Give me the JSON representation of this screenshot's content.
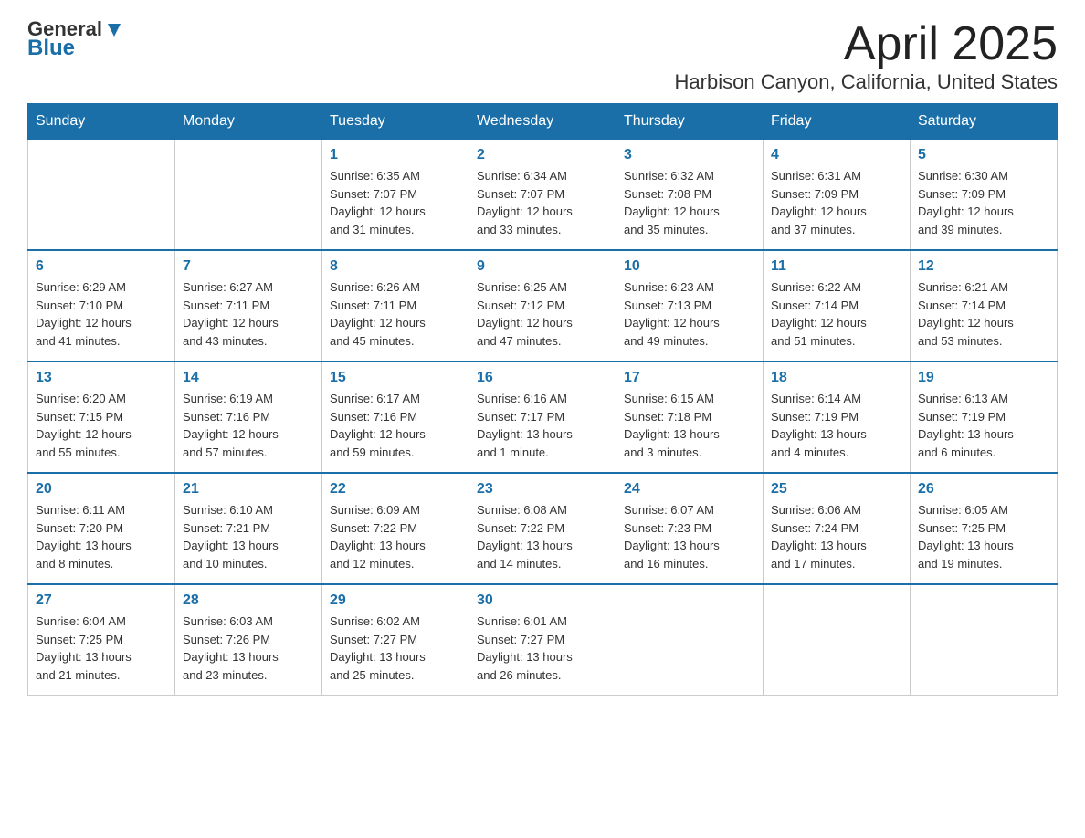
{
  "title": "April 2025",
  "subtitle": "Harbison Canyon, California, United States",
  "logo": {
    "line1": "General",
    "line2": "Blue"
  },
  "weekdays": [
    "Sunday",
    "Monday",
    "Tuesday",
    "Wednesday",
    "Thursday",
    "Friday",
    "Saturday"
  ],
  "weeks": [
    [
      {
        "day": "",
        "info": ""
      },
      {
        "day": "",
        "info": ""
      },
      {
        "day": "1",
        "info": "Sunrise: 6:35 AM\nSunset: 7:07 PM\nDaylight: 12 hours\nand 31 minutes."
      },
      {
        "day": "2",
        "info": "Sunrise: 6:34 AM\nSunset: 7:07 PM\nDaylight: 12 hours\nand 33 minutes."
      },
      {
        "day": "3",
        "info": "Sunrise: 6:32 AM\nSunset: 7:08 PM\nDaylight: 12 hours\nand 35 minutes."
      },
      {
        "day": "4",
        "info": "Sunrise: 6:31 AM\nSunset: 7:09 PM\nDaylight: 12 hours\nand 37 minutes."
      },
      {
        "day": "5",
        "info": "Sunrise: 6:30 AM\nSunset: 7:09 PM\nDaylight: 12 hours\nand 39 minutes."
      }
    ],
    [
      {
        "day": "6",
        "info": "Sunrise: 6:29 AM\nSunset: 7:10 PM\nDaylight: 12 hours\nand 41 minutes."
      },
      {
        "day": "7",
        "info": "Sunrise: 6:27 AM\nSunset: 7:11 PM\nDaylight: 12 hours\nand 43 minutes."
      },
      {
        "day": "8",
        "info": "Sunrise: 6:26 AM\nSunset: 7:11 PM\nDaylight: 12 hours\nand 45 minutes."
      },
      {
        "day": "9",
        "info": "Sunrise: 6:25 AM\nSunset: 7:12 PM\nDaylight: 12 hours\nand 47 minutes."
      },
      {
        "day": "10",
        "info": "Sunrise: 6:23 AM\nSunset: 7:13 PM\nDaylight: 12 hours\nand 49 minutes."
      },
      {
        "day": "11",
        "info": "Sunrise: 6:22 AM\nSunset: 7:14 PM\nDaylight: 12 hours\nand 51 minutes."
      },
      {
        "day": "12",
        "info": "Sunrise: 6:21 AM\nSunset: 7:14 PM\nDaylight: 12 hours\nand 53 minutes."
      }
    ],
    [
      {
        "day": "13",
        "info": "Sunrise: 6:20 AM\nSunset: 7:15 PM\nDaylight: 12 hours\nand 55 minutes."
      },
      {
        "day": "14",
        "info": "Sunrise: 6:19 AM\nSunset: 7:16 PM\nDaylight: 12 hours\nand 57 minutes."
      },
      {
        "day": "15",
        "info": "Sunrise: 6:17 AM\nSunset: 7:16 PM\nDaylight: 12 hours\nand 59 minutes."
      },
      {
        "day": "16",
        "info": "Sunrise: 6:16 AM\nSunset: 7:17 PM\nDaylight: 13 hours\nand 1 minute."
      },
      {
        "day": "17",
        "info": "Sunrise: 6:15 AM\nSunset: 7:18 PM\nDaylight: 13 hours\nand 3 minutes."
      },
      {
        "day": "18",
        "info": "Sunrise: 6:14 AM\nSunset: 7:19 PM\nDaylight: 13 hours\nand 4 minutes."
      },
      {
        "day": "19",
        "info": "Sunrise: 6:13 AM\nSunset: 7:19 PM\nDaylight: 13 hours\nand 6 minutes."
      }
    ],
    [
      {
        "day": "20",
        "info": "Sunrise: 6:11 AM\nSunset: 7:20 PM\nDaylight: 13 hours\nand 8 minutes."
      },
      {
        "day": "21",
        "info": "Sunrise: 6:10 AM\nSunset: 7:21 PM\nDaylight: 13 hours\nand 10 minutes."
      },
      {
        "day": "22",
        "info": "Sunrise: 6:09 AM\nSunset: 7:22 PM\nDaylight: 13 hours\nand 12 minutes."
      },
      {
        "day": "23",
        "info": "Sunrise: 6:08 AM\nSunset: 7:22 PM\nDaylight: 13 hours\nand 14 minutes."
      },
      {
        "day": "24",
        "info": "Sunrise: 6:07 AM\nSunset: 7:23 PM\nDaylight: 13 hours\nand 16 minutes."
      },
      {
        "day": "25",
        "info": "Sunrise: 6:06 AM\nSunset: 7:24 PM\nDaylight: 13 hours\nand 17 minutes."
      },
      {
        "day": "26",
        "info": "Sunrise: 6:05 AM\nSunset: 7:25 PM\nDaylight: 13 hours\nand 19 minutes."
      }
    ],
    [
      {
        "day": "27",
        "info": "Sunrise: 6:04 AM\nSunset: 7:25 PM\nDaylight: 13 hours\nand 21 minutes."
      },
      {
        "day": "28",
        "info": "Sunrise: 6:03 AM\nSunset: 7:26 PM\nDaylight: 13 hours\nand 23 minutes."
      },
      {
        "day": "29",
        "info": "Sunrise: 6:02 AM\nSunset: 7:27 PM\nDaylight: 13 hours\nand 25 minutes."
      },
      {
        "day": "30",
        "info": "Sunrise: 6:01 AM\nSunset: 7:27 PM\nDaylight: 13 hours\nand 26 minutes."
      },
      {
        "day": "",
        "info": ""
      },
      {
        "day": "",
        "info": ""
      },
      {
        "day": "",
        "info": ""
      }
    ]
  ]
}
